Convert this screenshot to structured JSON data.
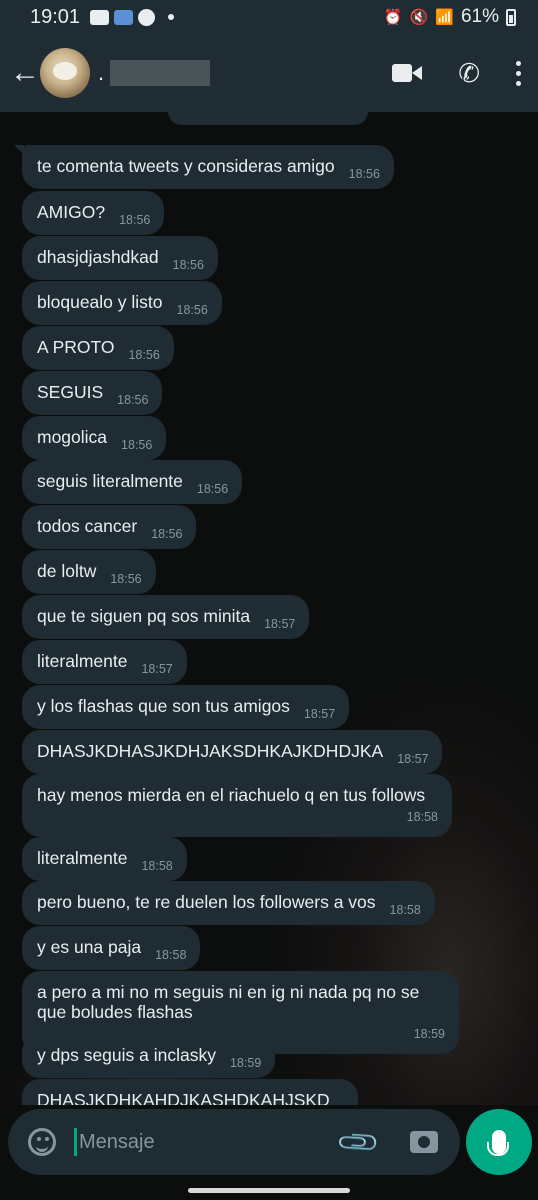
{
  "status_bar": {
    "time": "19:01",
    "battery": "61%",
    "icons_left": [
      "youtube-icon",
      "news-icon",
      "game-icon"
    ],
    "icons_right": [
      "alarm-icon",
      "mute-icon",
      "wifi-icon",
      "signal-icon",
      "battery-icon"
    ]
  },
  "header": {
    "contact_name": ".",
    "name_redacted": true,
    "actions": [
      "video-call-icon",
      "voice-call-icon",
      "more-options-icon"
    ]
  },
  "messages": [
    {
      "text": "te comenta tweets y consideras amigo",
      "time": "18:56"
    },
    {
      "text": "AMIGO?",
      "time": "18:56"
    },
    {
      "text": "dhasjdjashdkad",
      "time": "18:56"
    },
    {
      "text": "bloquealo y listo",
      "time": "18:56"
    },
    {
      "text": "A PROTO",
      "time": "18:56"
    },
    {
      "text": "SEGUIS",
      "time": "18:56"
    },
    {
      "text": "mogolica",
      "time": "18:56"
    },
    {
      "text": "seguis literalmente",
      "time": "18:56"
    },
    {
      "text": "todos cancer",
      "time": "18:56"
    },
    {
      "text": "de loltw",
      "time": "18:56"
    },
    {
      "text": "que te siguen pq sos minita",
      "time": "18:57"
    },
    {
      "text": "literalmente",
      "time": "18:57"
    },
    {
      "text": "y los flashas que son tus amigos",
      "time": "18:57"
    },
    {
      "text": "DHASJKDHASJKDHJAKSDHKAJKDHDJKA",
      "time": "18:57"
    },
    {
      "text": "hay menos mierda en el riachuelo q en tus follows",
      "time": "18:58"
    },
    {
      "text": "literalmente",
      "time": "18:58"
    },
    {
      "text": "pero bueno, te re duelen los followers a vos",
      "time": "18:58"
    },
    {
      "text": "y es una paja",
      "time": "18:58"
    },
    {
      "text": "a pero a mi no m seguis ni en ig ni nada pq no se que boludes flashas",
      "time": "18:59"
    },
    {
      "text": "y dps seguis a inclasky",
      "time": "18:59"
    },
    {
      "text": "DHASJKDHKAHDJKASHDKAHJSKD",
      "time": ""
    }
  ],
  "composer": {
    "placeholder": "Mensaje",
    "value": ""
  },
  "colors": {
    "bubble": "#1f2c33",
    "accent": "#00a884",
    "timestamp": "#8696a0"
  }
}
